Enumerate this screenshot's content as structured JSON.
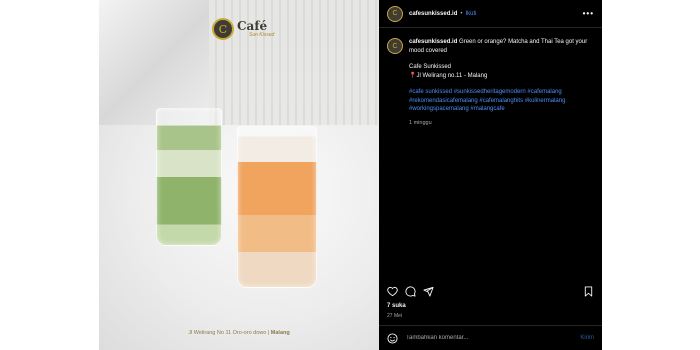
{
  "photo": {
    "logo_mark": "C",
    "logo_text": "Café",
    "logo_sub": "Sun Kissed",
    "address_caption": "Jl Welirang No 11 Oro-oro dowo |",
    "address_city": "Malang"
  },
  "header": {
    "username": "cafesunkissed.id",
    "separator": "•",
    "follow_label": "Ikuti",
    "more_label": "•••"
  },
  "post": {
    "username": "cafesunkissed.id",
    "text_line1": "Green or orange? Matcha and Thai Tea got your mood covered",
    "venue": "Cafe Sunkissed",
    "location": "📍Jl Welirang no.11 - Malang",
    "tags_line1": "#cafe sunkissed #sunkissedheritagemodern #cafemalang",
    "tags_line2": "#rekomendasicafemalang #cafemalanghits #kulinermalang",
    "tags_line3": "#workingspacemalang #malangcafe",
    "time_ago": "1 minggu"
  },
  "actions": {
    "like_icon": "heart-icon",
    "comment_icon": "comment-icon",
    "share_icon": "send-icon",
    "save_icon": "bookmark-icon"
  },
  "stats": {
    "likes": "7 suka",
    "date": "27 Mei"
  },
  "comment": {
    "placeholder": "Tambahkan komentar...",
    "post_label": "Kirim"
  },
  "colors": {
    "background": "#000000",
    "link": "#4a8ff5",
    "muted": "#a8a8a8",
    "brand_gold": "#c9a83a"
  }
}
